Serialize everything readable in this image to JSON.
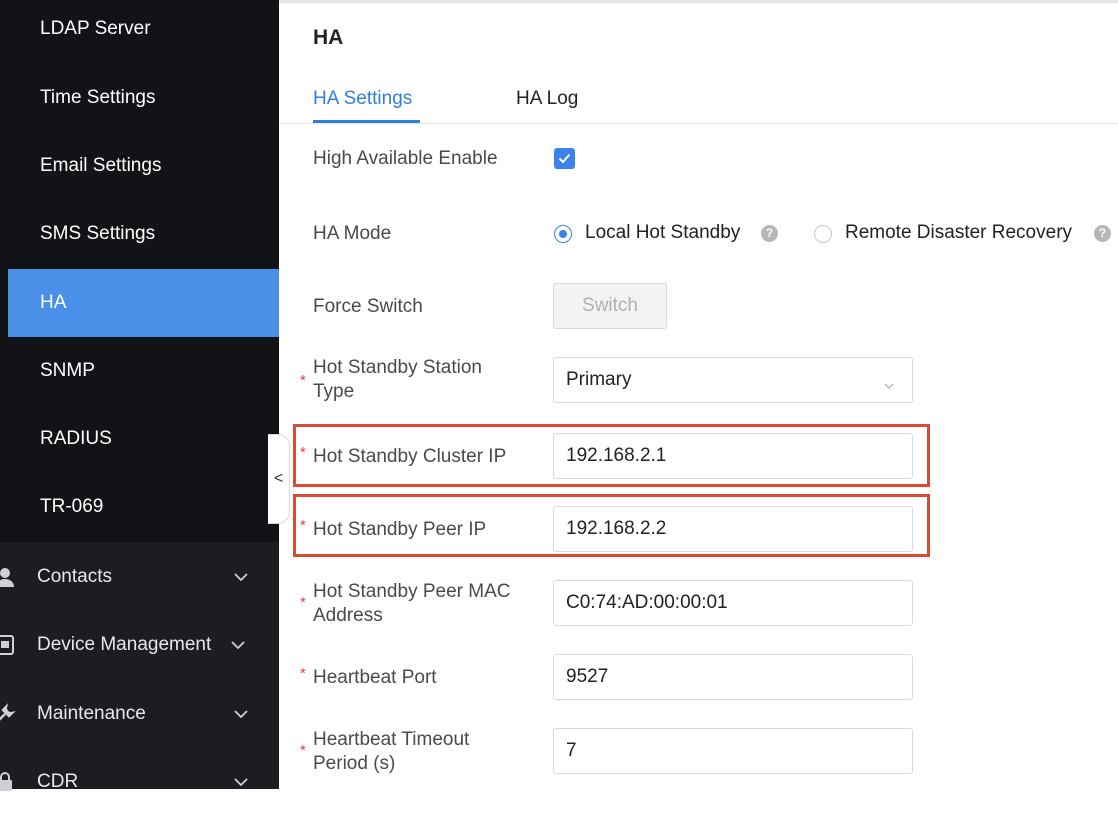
{
  "sidebar": {
    "sub_items": [
      {
        "label": "LDAP Server"
      },
      {
        "label": "Time Settings"
      },
      {
        "label": "Email Settings"
      },
      {
        "label": "SMS Settings"
      },
      {
        "label": "HA",
        "active": true
      },
      {
        "label": "SNMP"
      },
      {
        "label": "RADIUS"
      },
      {
        "label": "TR-069"
      }
    ],
    "groups": [
      {
        "label": "Contacts",
        "icon": "user-icon"
      },
      {
        "label": "Device Management",
        "icon": "device-icon"
      },
      {
        "label": "Maintenance",
        "icon": "wrench-icon"
      },
      {
        "label": "CDR",
        "icon": "lock-icon"
      }
    ],
    "collapse_glyph": "<"
  },
  "page": {
    "title": "HA",
    "tabs": [
      {
        "label": "HA Settings",
        "active": true
      },
      {
        "label": "HA Log"
      }
    ]
  },
  "form": {
    "ha_enable": {
      "label": "High Available Enable",
      "checked": true
    },
    "ha_mode": {
      "label": "HA Mode",
      "options": [
        {
          "label": "Local Hot Standby",
          "selected": true
        },
        {
          "label": "Remote Disaster Recovery",
          "selected": false
        }
      ]
    },
    "force_switch": {
      "label": "Force Switch",
      "button": "Switch"
    },
    "station_type": {
      "label_line1": "Hot Standby Station",
      "label_line2": "Type",
      "value": "Primary"
    },
    "cluster_ip": {
      "label": "Hot Standby Cluster IP",
      "value": "192.168.2.1"
    },
    "peer_ip": {
      "label": "Hot Standby Peer IP",
      "value": "192.168.2.2"
    },
    "peer_mac": {
      "label_line1": "Hot Standby Peer MAC",
      "label_line2": "Address",
      "value": "C0:74:AD:00:00:01"
    },
    "heartbeat_port": {
      "label": "Heartbeat Port",
      "value": "9527"
    },
    "heartbeat_timeout": {
      "label_line1": "Heartbeat Timeout",
      "label_line2": "Period (s)",
      "value": "7"
    },
    "required_mark": "*"
  },
  "colors": {
    "accent": "#3b83e6",
    "sidebar_bg": "#1c1d22",
    "highlight_border": "#dd4a32",
    "required": "#e0453a"
  }
}
